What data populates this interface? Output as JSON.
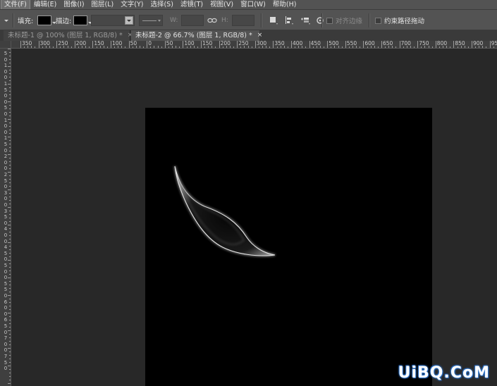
{
  "menu": {
    "items": [
      {
        "label": "文件(F)",
        "active": true
      },
      {
        "label": "编辑(E)",
        "active": false
      },
      {
        "label": "图像(I)",
        "active": false
      },
      {
        "label": "图层(L)",
        "active": false
      },
      {
        "label": "文字(Y)",
        "active": false
      },
      {
        "label": "选择(S)",
        "active": false
      },
      {
        "label": "滤镜(T)",
        "active": false
      },
      {
        "label": "视图(V)",
        "active": false
      },
      {
        "label": "窗口(W)",
        "active": false
      },
      {
        "label": "帮助(H)",
        "active": false
      }
    ]
  },
  "options": {
    "fill_label": "填充:",
    "stroke_label": "描边:",
    "width_label": "W:",
    "height_label": "H:",
    "align_edges_label": "对齐边缘",
    "constrain_path_label": "约束路径拖动",
    "fill_color": "#000000",
    "stroke_color": "#000000"
  },
  "tabs": [
    {
      "label": "未标题-1 @ 100% (图层 1, RGB/8) *",
      "close": "×",
      "active": false
    },
    {
      "label": "未标题-2 @ 66.7% (图层 1, RGB/8) *",
      "close": "×",
      "active": true
    }
  ],
  "ruler_h": {
    "labels": [
      "350",
      "300",
      "250",
      "200",
      "150",
      "100",
      "50",
      "0",
      "50",
      "100",
      "150",
      "200",
      "250",
      "300",
      "350",
      "400",
      "450",
      "500",
      "550",
      "600",
      "650",
      "700",
      "750",
      "800",
      "850",
      "900",
      "950"
    ]
  },
  "ruler_v": {
    "labels": [
      "5",
      "0",
      "1",
      "0",
      "0",
      "1",
      "5",
      "0",
      "0",
      "5",
      "0",
      "1",
      "0",
      "0",
      "1",
      "5",
      "0",
      "2",
      "0",
      "0",
      "2",
      "5",
      "0",
      "3",
      "0",
      "0",
      "3",
      "5",
      "0",
      "4",
      "0",
      "0",
      "4",
      "5",
      "0",
      "5",
      "0",
      "0",
      "5",
      "5",
      "0",
      "6",
      "0",
      "0",
      "6",
      "5",
      "0",
      "7",
      "0",
      "0",
      "7",
      "5",
      "0"
    ]
  },
  "watermark": "UiBQ.CoM",
  "colors": {
    "ui_gray": "#535353",
    "workspace": "#282828",
    "document": "#000000"
  }
}
